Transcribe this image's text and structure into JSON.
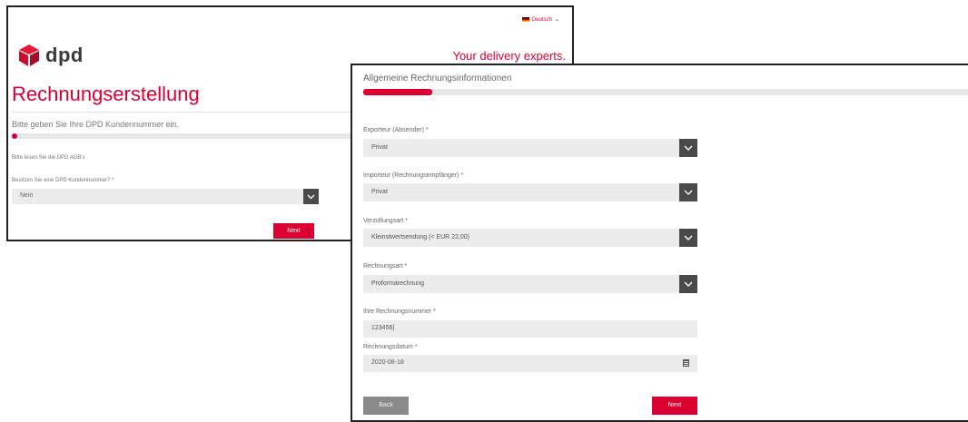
{
  "colors": {
    "accent": "#dc0032",
    "field_bg": "#ececec",
    "dropdown_btn": "#4a4a4a",
    "back_btn": "#8a8a8a"
  },
  "window1": {
    "language": "Deutsch",
    "logo_text": "dpd",
    "tagline": "Your delivery experts.",
    "title": "Rechnungserstellung",
    "instruction": "Bitte geben Sie Ihre DPD Kundennummer ein.",
    "agb_text": "Bitte lesen Sie die DPD AGB's",
    "question_label": "Besitzen Sie eine DPD Kundennummer? *",
    "question_value": "Nein",
    "next_label": "Next"
  },
  "window2": {
    "title": "Allgemeine Rechnungsinformationen",
    "exporter_label": "Exporteur (Absender) *",
    "exporter_value": "Privat",
    "importer_label": "Importeur (Rechnungsempfänger) *",
    "importer_value": "Privat",
    "customs_label": "Verzollungsart *",
    "customs_value": "Kleinstwertsendung (< EUR 22,00)",
    "invoice_type_label": "Rechnungsart *",
    "invoice_type_value": "Proformarechnung",
    "invoice_number_label": "Ihre Rechnungsnummer *",
    "invoice_number_value": "123456|",
    "invoice_date_label": "Rechnungsdatum *",
    "invoice_date_value": "2020-08-18",
    "back_label": "Back",
    "next_label": "Next"
  }
}
